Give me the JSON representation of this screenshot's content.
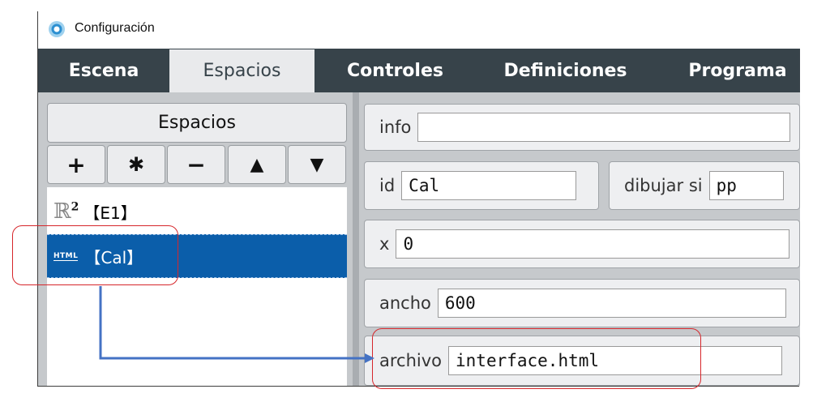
{
  "window": {
    "title": "Configuración"
  },
  "tabs": [
    {
      "label": "Escena"
    },
    {
      "label": "Espacios"
    },
    {
      "label": "Controles"
    },
    {
      "label": "Definiciones"
    },
    {
      "label": "Programa"
    }
  ],
  "left_panel": {
    "header": "Espacios",
    "toolbar": {
      "add": "+",
      "duplicate": "✱",
      "remove": "−",
      "up": "▲",
      "down": "▼"
    },
    "items": [
      {
        "type_icon": "ℝ",
        "type_sup": "2",
        "label": "【E1】"
      },
      {
        "type_icon": "HTML",
        "label": "【Cal】"
      }
    ]
  },
  "fields": {
    "info": {
      "label": "info",
      "value": ""
    },
    "id": {
      "label": "id",
      "value": "Cal"
    },
    "dibujar_si": {
      "label": "dibujar si",
      "value": "pp"
    },
    "x": {
      "label": "x",
      "value": "0"
    },
    "ancho": {
      "label": "ancho",
      "value": "600"
    },
    "archivo": {
      "label": "archivo",
      "value": "interface.html"
    }
  },
  "colors": {
    "tabbar": "#37434a",
    "selection": "#0b5eaa",
    "annotation": "#d6262b",
    "arrow": "#4472c4"
  }
}
